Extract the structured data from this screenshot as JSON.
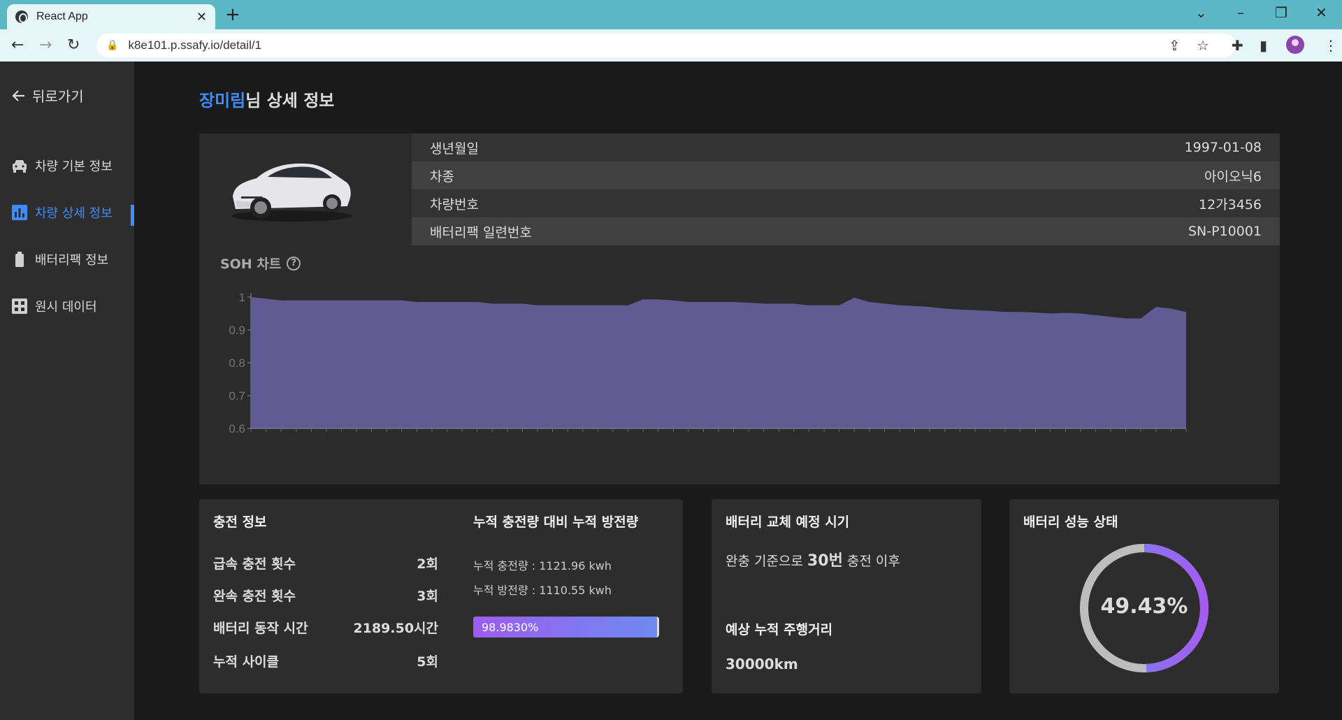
{
  "browser": {
    "tab_title": "React App",
    "tab_close": "✕",
    "new_tab": "+",
    "url": "k8e101.p.ssafy.io/detail/1"
  },
  "sidebar": {
    "back": "뒤로가기",
    "items": [
      {
        "label": "차량 기본 정보",
        "icon": "car-icon"
      },
      {
        "label": "차량 상세 정보",
        "icon": "bar-chart-icon",
        "active": true
      },
      {
        "label": "배터리팩 정보",
        "icon": "battery-icon"
      },
      {
        "label": "원시 데이터",
        "icon": "grid-icon"
      }
    ]
  },
  "header": {
    "name": "장미림",
    "suffix": "님 상세 정보"
  },
  "info": {
    "rows": [
      {
        "label": "생년월일",
        "value": "1997-01-08"
      },
      {
        "label": "차종",
        "value": "아이오닉6"
      },
      {
        "label": "차량번호",
        "value": "12가3456"
      },
      {
        "label": "배터리팩 일련번호",
        "value": "SN-P10001"
      }
    ]
  },
  "soh": {
    "title": "SOH 차트",
    "help": "?"
  },
  "chart_data": {
    "type": "area",
    "ylim": [
      0.6,
      1
    ],
    "yticks": [
      "1",
      "0.9",
      "0.8",
      "0.7",
      "0.6"
    ],
    "color": "#625b93",
    "values": [
      1.0,
      0.995,
      0.99,
      0.99,
      0.99,
      0.99,
      0.99,
      0.99,
      0.99,
      0.99,
      0.99,
      0.985,
      0.985,
      0.985,
      0.985,
      0.985,
      0.98,
      0.98,
      0.98,
      0.975,
      0.975,
      0.975,
      0.975,
      0.975,
      0.975,
      0.975,
      0.993,
      0.993,
      0.99,
      0.985,
      0.985,
      0.985,
      0.985,
      0.983,
      0.98,
      0.98,
      0.98,
      0.975,
      0.975,
      0.975,
      0.998,
      0.985,
      0.98,
      0.975,
      0.973,
      0.97,
      0.965,
      0.962,
      0.96,
      0.958,
      0.955,
      0.955,
      0.953,
      0.95,
      0.952,
      0.95,
      0.945,
      0.94,
      0.935,
      0.935,
      0.97,
      0.965,
      0.955
    ]
  },
  "charge": {
    "title": "충전 정보",
    "rows": [
      {
        "label": "급속 충전 횟수",
        "value": "2회"
      },
      {
        "label": "완속 충전 횟수",
        "value": "3회"
      },
      {
        "label": "배터리 동작 시간",
        "value": "2189.50시간"
      },
      {
        "label": "누적 사이클",
        "value": "5회"
      }
    ],
    "ratio_title": "누적 충전량 대비 누적 방전량",
    "charged": "누적 충전량 : 1121.96 kwh",
    "discharged": "누적 방전량 : 1110.55 kwh",
    "ratio": 0.98983,
    "ratio_label": "98.9830%"
  },
  "replace": {
    "title": "배터리 교체 예정 시기",
    "prefix": "완충 기준으로",
    "count": "30번",
    "suffix": "충전 이후",
    "distance_title": "예상 누적 주행거리",
    "distance": "30000km"
  },
  "health": {
    "title": "배터리 성능 상태",
    "value": 0.4943,
    "label": "49.43%"
  }
}
